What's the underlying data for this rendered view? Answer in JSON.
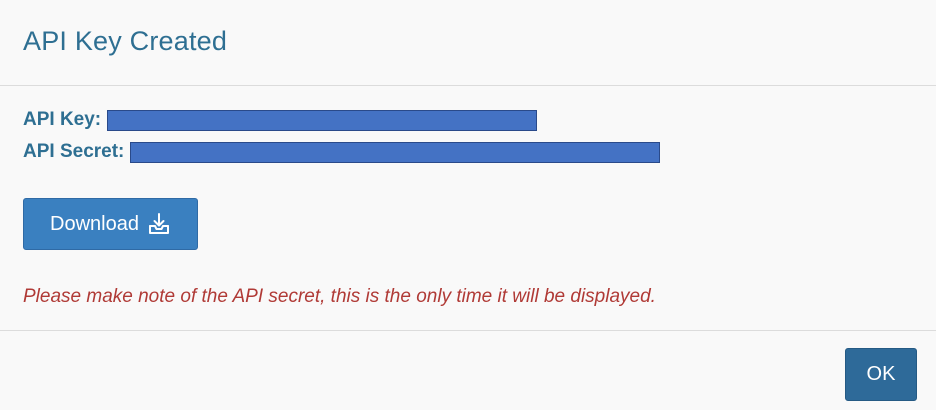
{
  "dialog": {
    "title": "API Key Created",
    "api_key_label": "API Key:",
    "api_secret_label": "API Secret:",
    "download_label": "Download",
    "download_icon": "download-icon",
    "warning": "Please make note of the API secret, this is the only time it will be displayed.",
    "ok_label": "OK"
  },
  "colors": {
    "title": "#2e6f92",
    "redaction": "#4472c4",
    "download_button": "#3a80c0",
    "ok_button": "#2e6a99",
    "warning": "#b03a36"
  }
}
